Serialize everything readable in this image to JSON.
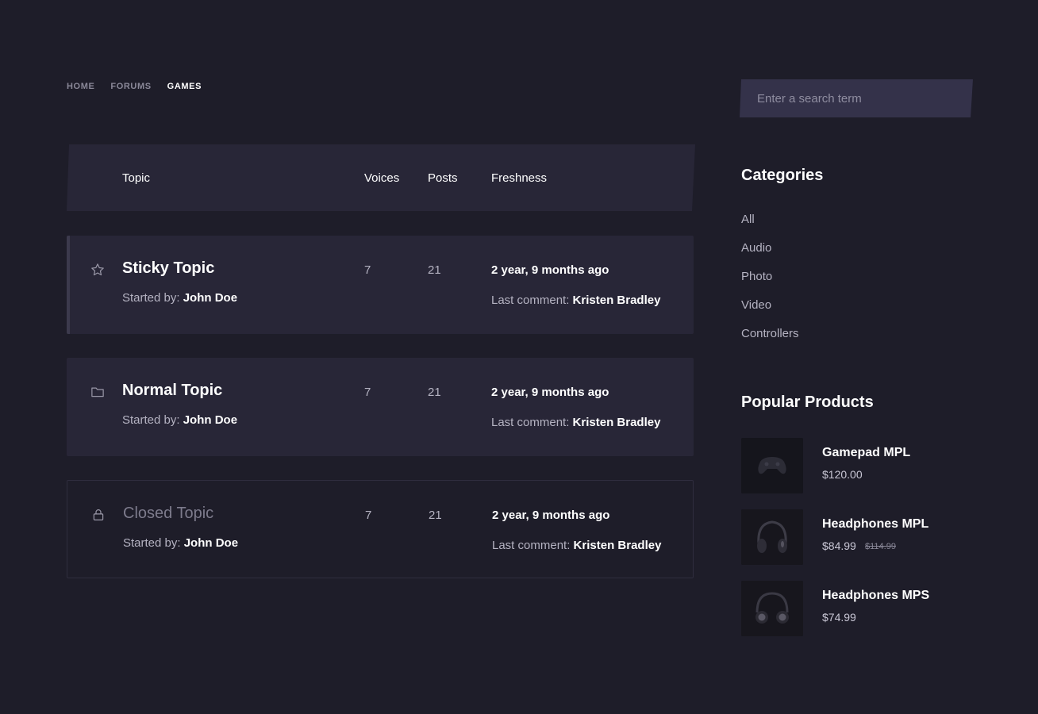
{
  "breadcrumb": {
    "home": "HOME",
    "forums": "FORUMS",
    "current": "GAMES"
  },
  "table": {
    "headers": {
      "topic": "Topic",
      "voices": "Voices",
      "posts": "Posts",
      "freshness": "Freshness"
    }
  },
  "topics": [
    {
      "title": "Sticky Topic",
      "status": "sticky",
      "icon": "star-icon",
      "started_label": "Started by:",
      "author": "John Doe",
      "voices": "7",
      "posts": "21",
      "freshness": "2 year, 9 months ago",
      "last_comment_label": "Last comment:",
      "last_comment_author": "Kristen Bradley"
    },
    {
      "title": "Normal Topic",
      "status": "normal",
      "icon": "folder-icon",
      "started_label": "Started by:",
      "author": "John Doe",
      "voices": "7",
      "posts": "21",
      "freshness": "2 year, 9 months ago",
      "last_comment_label": "Last comment:",
      "last_comment_author": "Kristen Bradley"
    },
    {
      "title": "Closed Topic",
      "status": "closed",
      "icon": "lock-icon",
      "started_label": "Started by:",
      "author": "John Doe",
      "voices": "7",
      "posts": "21",
      "freshness": "2 year, 9 months ago",
      "last_comment_label": "Last comment:",
      "last_comment_author": "Kristen Bradley"
    }
  ],
  "sidebar": {
    "search": {
      "placeholder": "Enter a search term",
      "value": ""
    },
    "categories_title": "Categories",
    "categories": [
      "All",
      "Audio",
      "Photo",
      "Video",
      "Controllers"
    ],
    "popular_title": "Popular Products",
    "products": [
      {
        "name": "Gamepad MPL",
        "price": "$120.00",
        "old_price": "",
        "image": "gamepad-image"
      },
      {
        "name": "Headphones MPL",
        "price": "$84.99",
        "old_price": "$114.99",
        "image": "headphones-image"
      },
      {
        "name": "Headphones MPS",
        "price": "$74.99",
        "old_price": "",
        "image": "headphones-image"
      }
    ]
  },
  "colors": {
    "background": "#1e1d29",
    "card": "#282637",
    "search_bg": "#34324a",
    "muted_text": "#b5b3c2",
    "heading_text": "#ffffff"
  }
}
